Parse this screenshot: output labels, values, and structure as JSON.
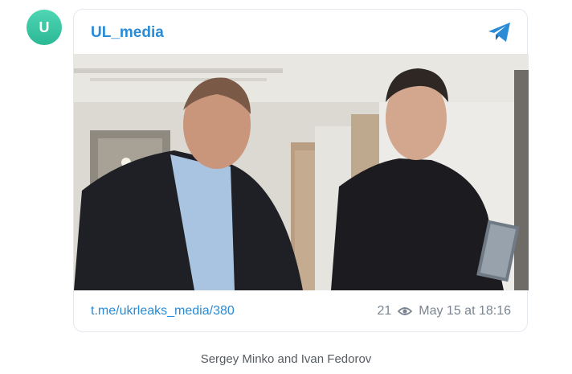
{
  "avatar": {
    "letter": "U",
    "color": "#34c79f"
  },
  "post": {
    "channel": "UL_media",
    "link": "t.me/ukrleaks_media/380",
    "views": "21",
    "date": "May 15 at 18:16",
    "icons": {
      "app": "telegram-icon",
      "views": "eye-icon"
    },
    "accent": "#2a8bd6"
  },
  "caption": "Sergey Minko and Ivan Fedorov"
}
